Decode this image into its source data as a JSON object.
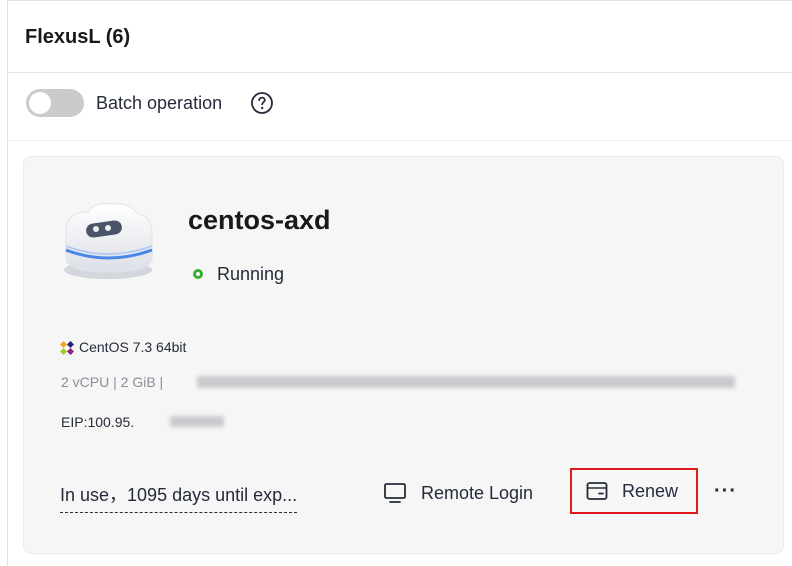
{
  "panel": {
    "title": "FlexusL (6)"
  },
  "batch": {
    "label": "Batch operation",
    "enabled": false
  },
  "instance": {
    "name": "centos-axd",
    "status": "Running",
    "status_color": "#36ad2f",
    "os": "CentOS 7.3 64bit",
    "specs": "2 vCPU | 2 GiB |",
    "eip": "EIP:100.95.",
    "expiry": "In use，1095 days until exp...",
    "actions": {
      "remote_login": "Remote Login",
      "renew": "Renew",
      "more": "···"
    }
  },
  "colors": {
    "highlight_border": "#e0191a",
    "toggle_off": "#cbcbcb",
    "card_bg": "#f6f6f6"
  },
  "icons": {
    "help": "question-circle-icon",
    "server": "cloud-server-icon",
    "os": "centos-logo-icon",
    "remote_login": "monitor-icon",
    "renew": "wallet-icon"
  }
}
